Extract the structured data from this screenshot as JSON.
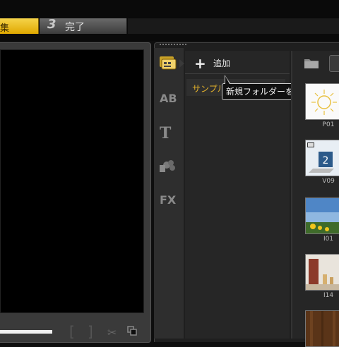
{
  "steps": {
    "active_label": "集",
    "step3_number": "3",
    "step3_label": "完了"
  },
  "preview": {
    "progress_fraction": 0.37
  },
  "library": {
    "add_label": "追加",
    "folder_label": "サンプル",
    "tooltip": "新規フォルダーを追加",
    "sidebar_tabs": [
      "AB",
      "T",
      "FX"
    ],
    "thumbnails": [
      {
        "label": "P01"
      },
      {
        "label": "V09"
      },
      {
        "label": "I01"
      },
      {
        "label": "I14"
      }
    ]
  },
  "colors": {
    "accent_yellow": "#f0c020",
    "folder_text": "#e6b32a"
  }
}
